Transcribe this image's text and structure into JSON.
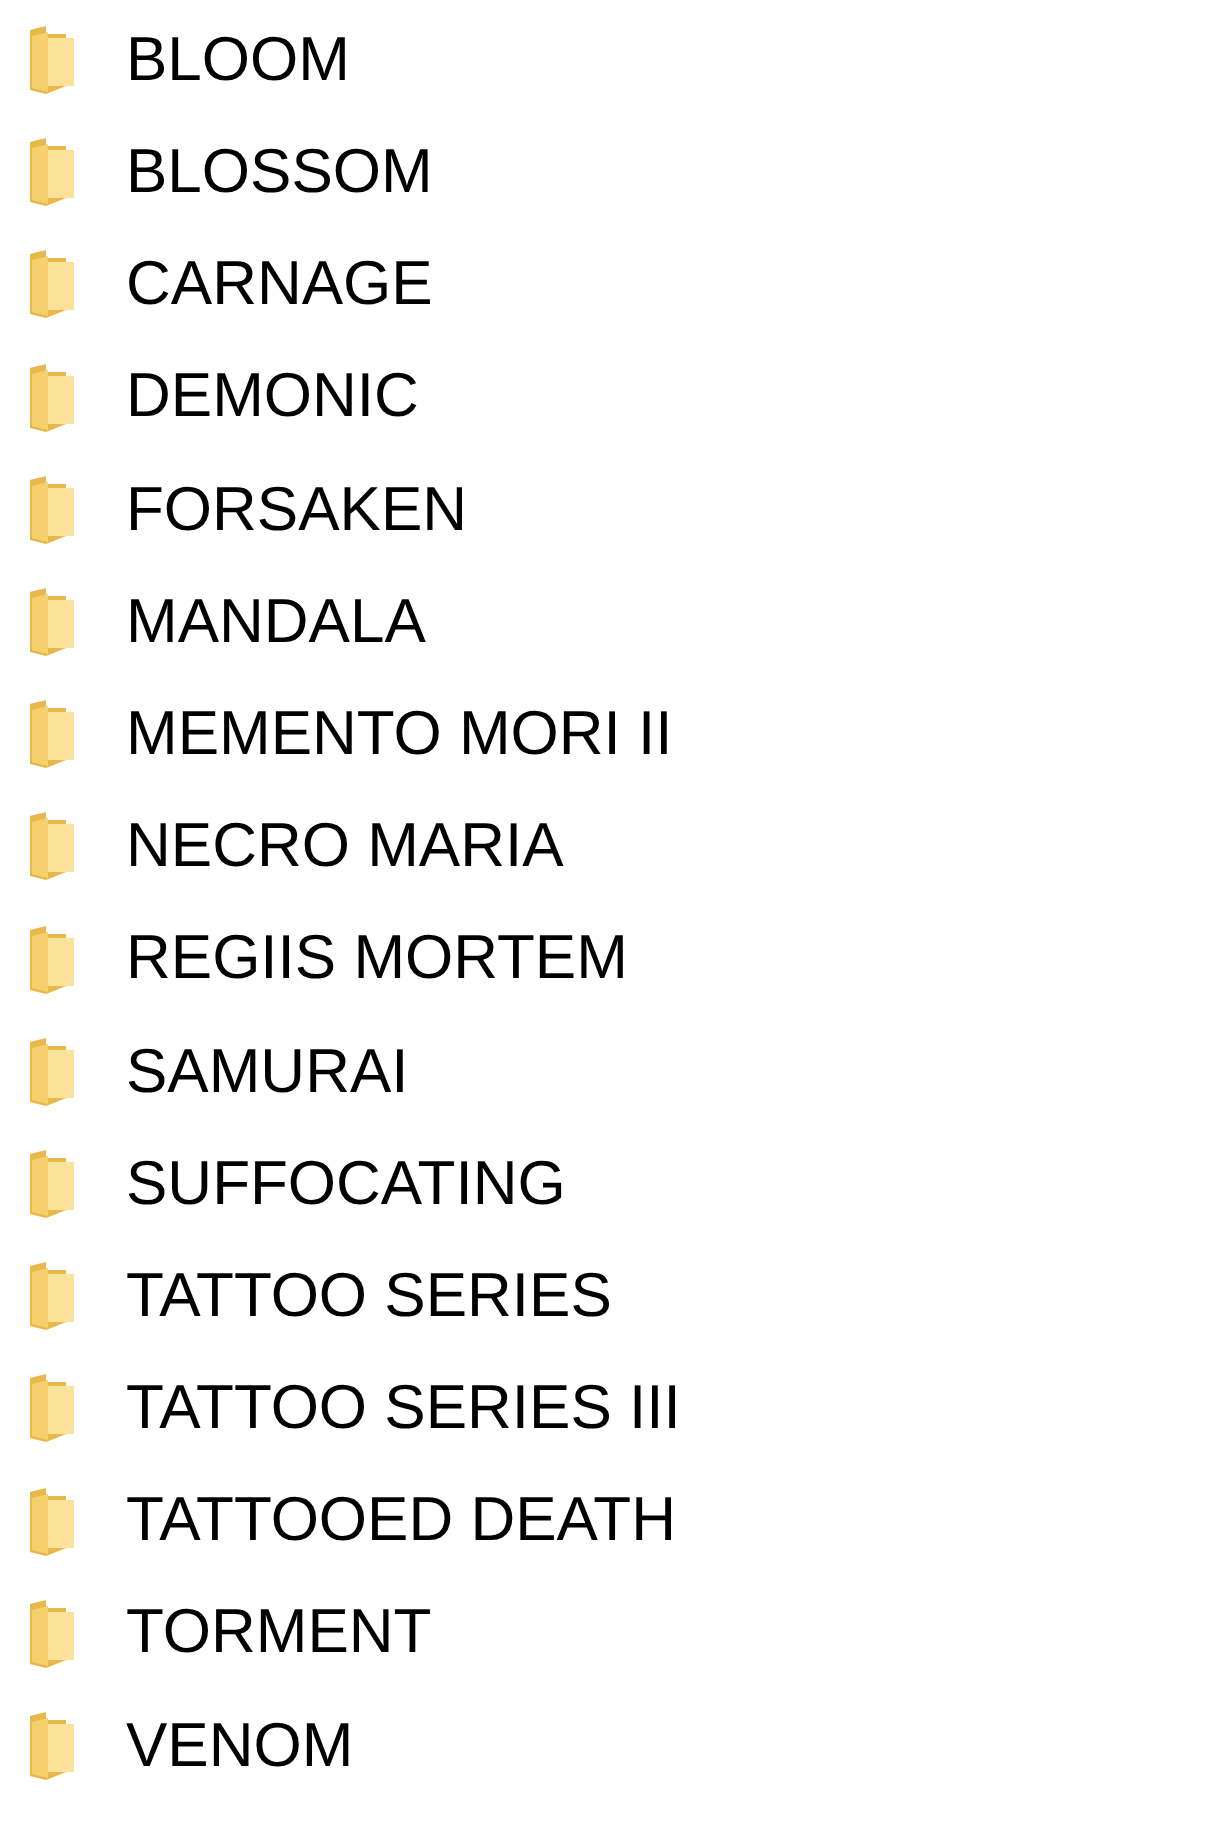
{
  "folders": [
    {
      "name": "BLOOM"
    },
    {
      "name": "BLOSSOM"
    },
    {
      "name": "CARNAGE"
    },
    {
      "name": "DEMONIC"
    },
    {
      "name": "FORSAKEN"
    },
    {
      "name": "MANDALA"
    },
    {
      "name": "MEMENTO MORI II"
    },
    {
      "name": "NECRO MARIA"
    },
    {
      "name": "REGIIS MORTEM"
    },
    {
      "name": "SAMURAI"
    },
    {
      "name": "SUFFOCATING"
    },
    {
      "name": "TATTOO SERIES"
    },
    {
      "name": "TATTOO SERIES III"
    },
    {
      "name": "TATTOOED DEATH"
    },
    {
      "name": "TORMENT"
    },
    {
      "name": "VENOM"
    }
  ]
}
